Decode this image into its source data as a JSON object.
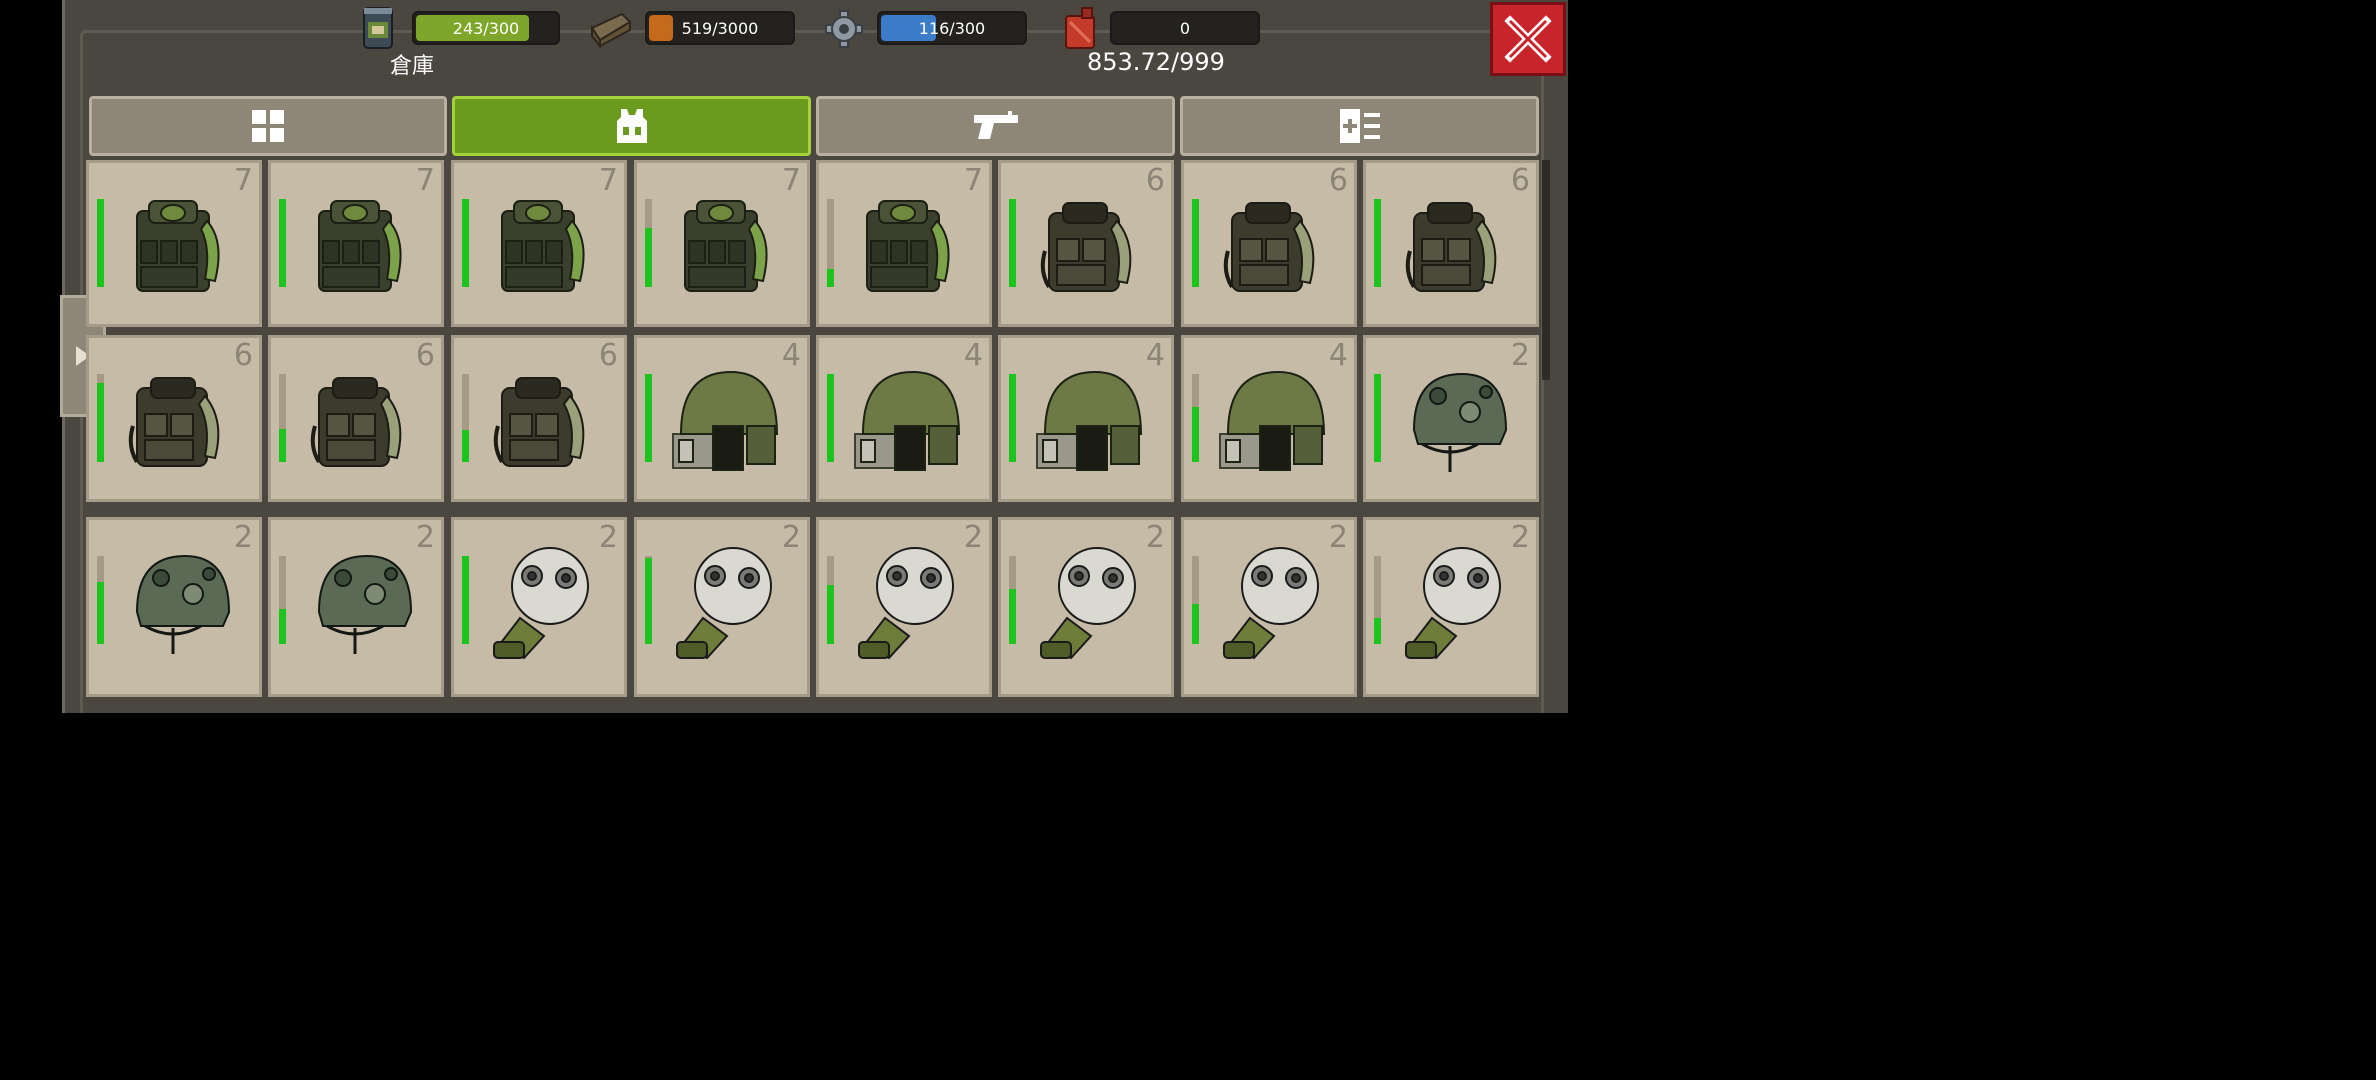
{
  "resources": {
    "food": {
      "icon": "canned-food-icon",
      "text": "243/300",
      "level": 0.81,
      "color": "#7ea62a"
    },
    "wood": {
      "icon": "wood-log-icon",
      "text": "519/3000",
      "level": 0.17,
      "color": "#c46a1c"
    },
    "parts": {
      "icon": "gear-icon",
      "text": "116/300",
      "level": 0.39,
      "color": "#3d7cc9"
    },
    "fuel": {
      "icon": "fuel-can-icon",
      "text": "0",
      "level": 0.0,
      "color": "#c43b2a"
    }
  },
  "storage_label": "倉庫",
  "weight_text": "853.72/999",
  "tabs": [
    {
      "name": "tab-all",
      "icon": "grid-icon",
      "active": false
    },
    {
      "name": "tab-armor",
      "icon": "armor-vest-icon",
      "active": true
    },
    {
      "name": "tab-weapons",
      "icon": "pistol-icon",
      "active": false
    },
    {
      "name": "tab-misc",
      "icon": "medkit-list-icon",
      "active": false
    }
  ],
  "items": [
    {
      "type": "vest",
      "count": "7",
      "durability": 1.0
    },
    {
      "type": "vest",
      "count": "7",
      "durability": 1.0
    },
    {
      "type": "vest",
      "count": "7",
      "durability": 1.0
    },
    {
      "type": "vest",
      "count": "7",
      "durability": 0.67
    },
    {
      "type": "vest",
      "count": "7",
      "durability": 0.2
    },
    {
      "type": "backpack-vest",
      "count": "6",
      "durability": 1.0
    },
    {
      "type": "backpack-vest",
      "count": "6",
      "durability": 1.0
    },
    {
      "type": "backpack-vest",
      "count": "6",
      "durability": 1.0
    },
    {
      "type": "backpack-vest",
      "count": "6",
      "durability": 0.9
    },
    {
      "type": "backpack-vest",
      "count": "6",
      "durability": 0.38
    },
    {
      "type": "backpack-vest",
      "count": "6",
      "durability": 0.36
    },
    {
      "type": "visor-helmet",
      "count": "4",
      "durability": 1.0
    },
    {
      "type": "visor-helmet",
      "count": "4",
      "durability": 1.0
    },
    {
      "type": "visor-helmet",
      "count": "4",
      "durability": 1.0
    },
    {
      "type": "visor-helmet",
      "count": "4",
      "durability": 0.62
    },
    {
      "type": "camo-helmet",
      "count": "2",
      "durability": 1.0
    },
    {
      "type": "camo-helmet",
      "count": "2",
      "durability": 0.7
    },
    {
      "type": "camo-helmet",
      "count": "2",
      "durability": 0.4
    },
    {
      "type": "gas-mask",
      "count": "2",
      "durability": 1.0
    },
    {
      "type": "gas-mask",
      "count": "2",
      "durability": 0.98
    },
    {
      "type": "gas-mask",
      "count": "2",
      "durability": 0.67
    },
    {
      "type": "gas-mask",
      "count": "2",
      "durability": 0.62
    },
    {
      "type": "gas-mask",
      "count": "2",
      "durability": 0.45
    },
    {
      "type": "gas-mask",
      "count": "2",
      "durability": 0.3
    }
  ],
  "colors": {
    "accent_green": "#6a9a1e",
    "close_red": "#c8242c",
    "cell_bg": "#c5bba7"
  }
}
